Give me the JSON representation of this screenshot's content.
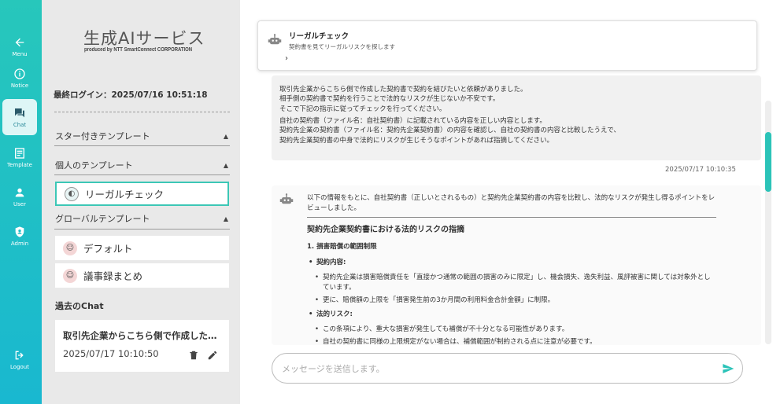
{
  "rail": {
    "menu": "Menu",
    "notice": "Notice",
    "chat": "Chat",
    "template": "Template",
    "user": "User",
    "admin": "Admin",
    "logout": "Logout"
  },
  "sidebar": {
    "brand_title": "生成AIサービス",
    "brand_sub": "produced by NTT SmartConnect CORPORATION",
    "last_login": "最終ログイン：2025/07/16 10:51:18",
    "starred_header": "スター付きテンプレート",
    "personal_header": "個人のテンプレート",
    "personal_templates": [
      "リーガルチェック"
    ],
    "global_header": "グローバルテンプレート",
    "global_templates": [
      "デフォルト",
      "議事録まとめ"
    ],
    "past_chat_label": "過去のChat",
    "past_chats": [
      {
        "title": "取引先企業からこちら側で作成した契約書で契約を結びたいと依頼がありました。",
        "time": "2025/07/17 10:10:50"
      }
    ]
  },
  "main": {
    "template_card": {
      "title": "リーガルチェック",
      "subtitle": "契約書を見てリーガルリスクを探します",
      "chevron": "›"
    },
    "user_message": {
      "paragraphs": [
        [
          "取引先企業からこちら側で作成した契約書で契約を結びたいと依頼がありました。",
          "相手側の契約書で契約を行うことで法的なリスクが生じないか不安です。",
          "そこで下記の指示に従ってチェックを行ってください。"
        ],
        [
          "自社の契約書（ファイル名：自社契約書）に記載されている内容を正しい内容とします。",
          "契約先企業の契約書（ファイル名：契約先企業契約書）の内容を確認し、自社の契約書の内容と比較したうえで、",
          "契約先企業契約書の中身で法的にリスクが生じそうなポイントがあれば指摘してください。"
        ]
      ],
      "time": "2025/07/17 10:10:35"
    },
    "bot_message": {
      "intro": "以下の情報をもとに、自社契約書（正しいとされるもの）と契約先企業契約書の内容を比較し、法的なリスクが発生し得るポイントをレビューしました。",
      "heading": "契約先企業契約書における法的リスクの指摘",
      "subheading": "1. 損害賠償の範囲制限",
      "sections": [
        {
          "label": "契約内容:",
          "items": [
            "契約先企業は損害賠償責任を「直接かつ通常の範囲の損害のみに限定」し、機会損失、逸失利益、風評被害に関しては対象外としています。",
            "更に、賠償額の上限を「損害発生前の3か月間の利用料金合計金額」に制限。"
          ]
        },
        {
          "label": "法的リスク:",
          "items": [
            "この条項により、重大な損害が発生しても補償が不十分となる可能性があります。",
            "自社の契約書に同様の上限規定がない場合は、補償範囲が制約される点に注意が必要です。"
          ]
        }
      ]
    },
    "input": {
      "placeholder": "メッセージを送信します。",
      "value": ""
    }
  },
  "colors": {
    "accent": "#2bc3b8",
    "rail_top": "#27c7bb",
    "sidebar_bg": "#e9e9e9"
  }
}
